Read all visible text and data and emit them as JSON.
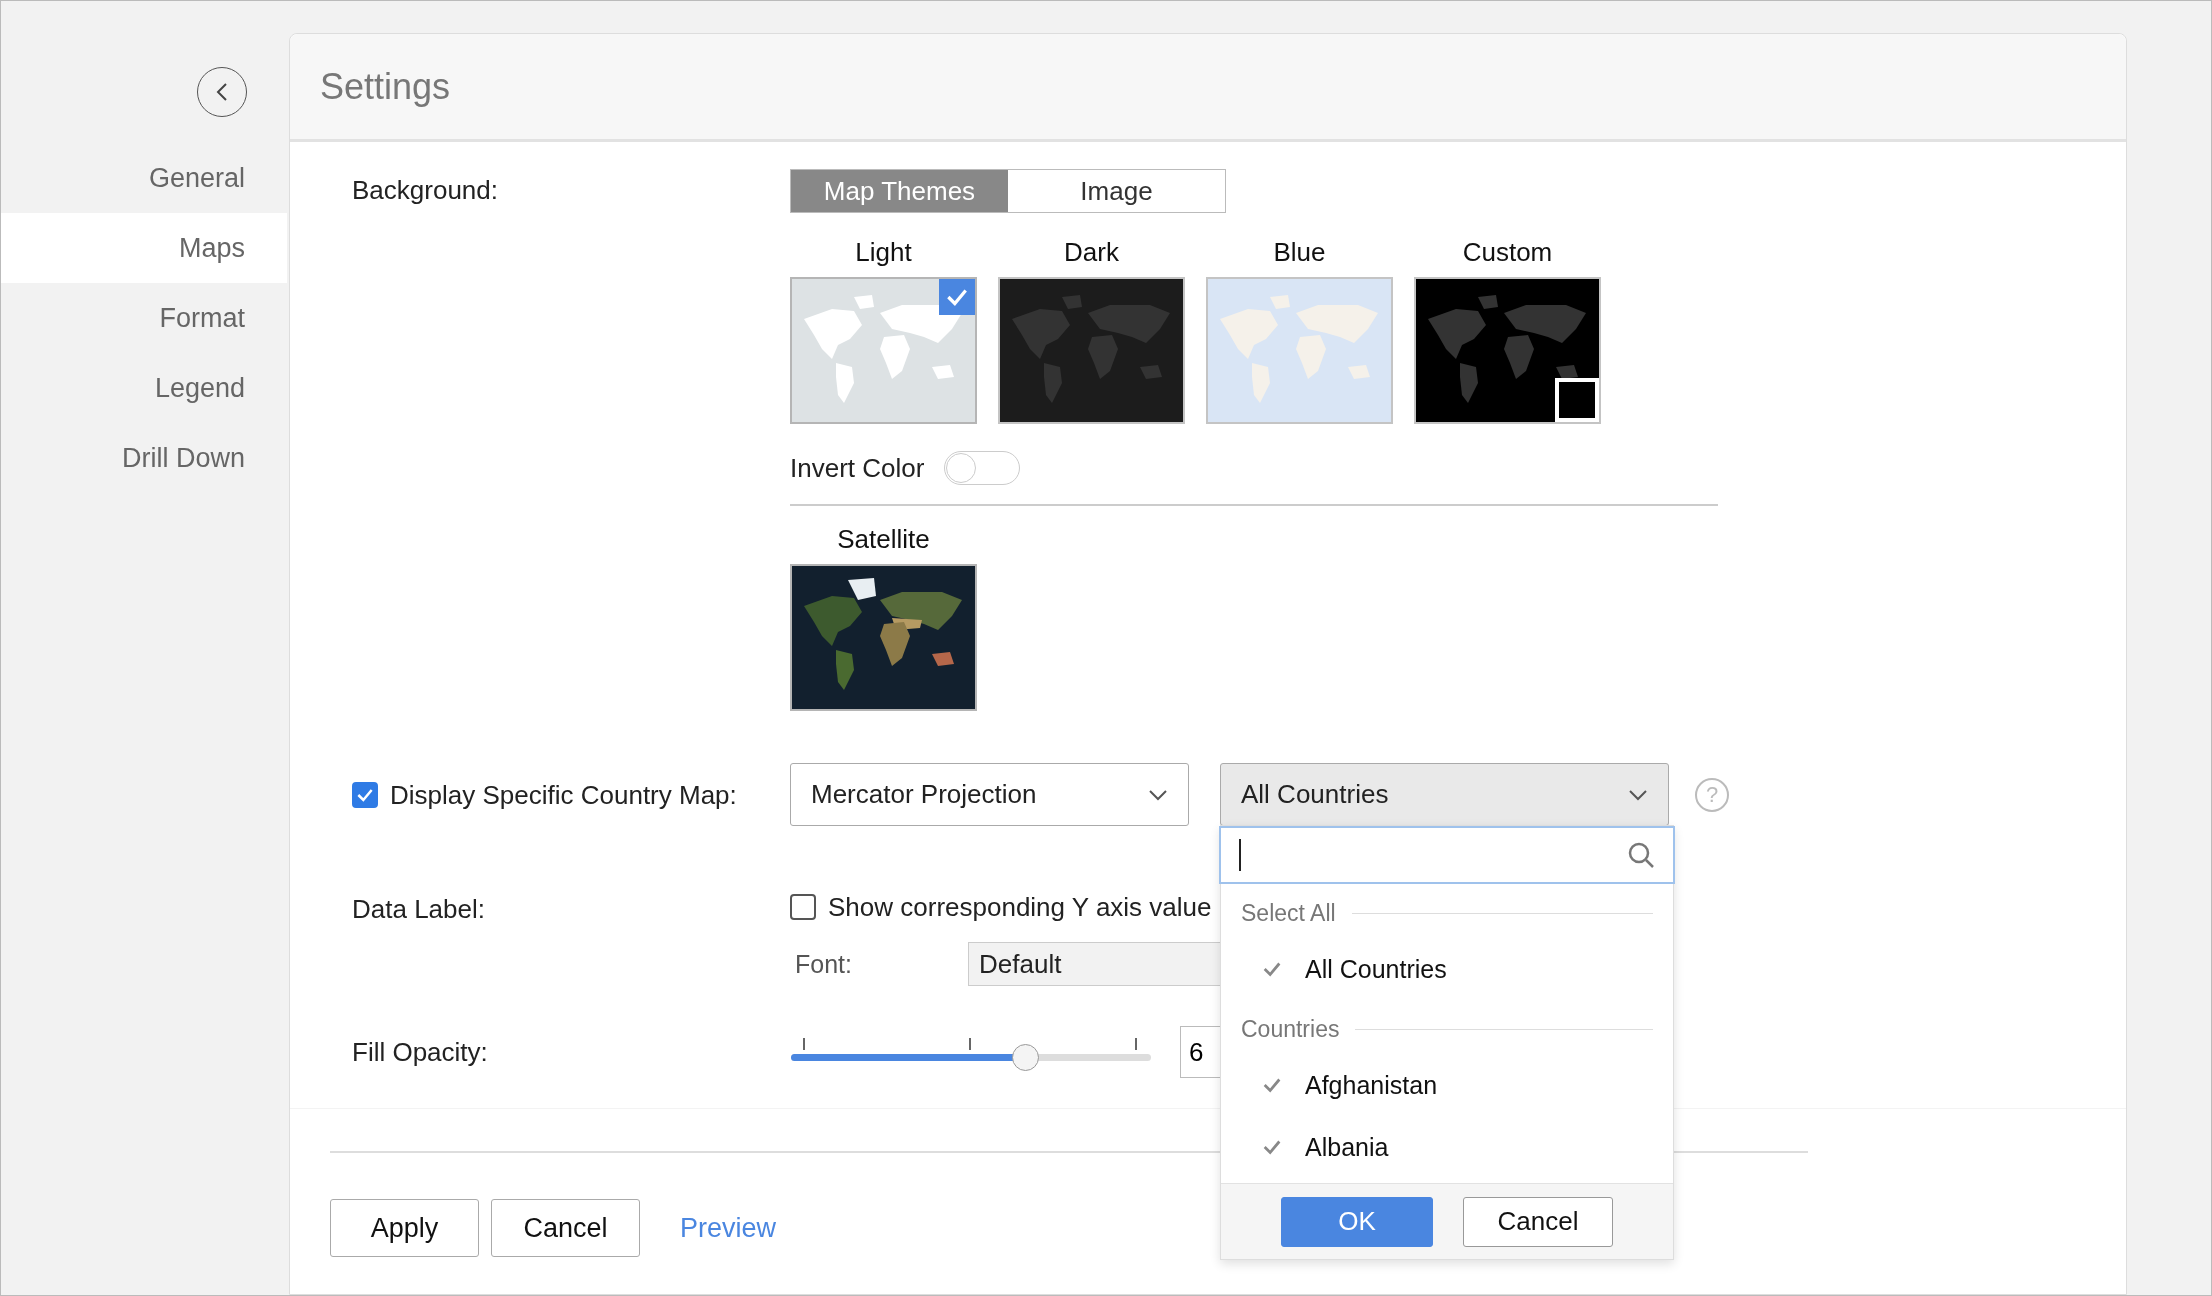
{
  "sidebar": {
    "items": [
      {
        "label": "General",
        "selected": false
      },
      {
        "label": "Maps",
        "selected": true
      },
      {
        "label": "Format",
        "selected": false
      },
      {
        "label": "Legend",
        "selected": false
      },
      {
        "label": "Drill Down",
        "selected": false
      }
    ]
  },
  "header": {
    "title": "Settings"
  },
  "background": {
    "label": "Background:",
    "tabs": [
      {
        "label": "Map Themes",
        "selected": true
      },
      {
        "label": "Image",
        "selected": false
      }
    ],
    "themes": [
      {
        "name": "Light",
        "kind": "light",
        "selected": true
      },
      {
        "name": "Dark",
        "kind": "dark",
        "selected": false
      },
      {
        "name": "Blue",
        "kind": "blue",
        "selected": false
      },
      {
        "name": "Custom",
        "kind": "custom",
        "selected": false,
        "color": "#000000"
      }
    ],
    "invert_color": {
      "label": "Invert Color",
      "on": false
    },
    "satellite": {
      "name": "Satellite",
      "selected": false
    }
  },
  "country_map": {
    "label": "Display Specific Country Map:",
    "checked": true,
    "projection": "Mercator Projection",
    "country": "All Countries",
    "dropdown": {
      "groups": [
        {
          "title": "Select All",
          "items": [
            {
              "label": "All Countries",
              "checked": true
            }
          ]
        },
        {
          "title": "Countries",
          "items": [
            {
              "label": "Afghanistan",
              "checked": true
            },
            {
              "label": "Albania",
              "checked": true
            }
          ]
        }
      ],
      "buttons": [
        "OK",
        "Cancel"
      ]
    },
    "help": "?"
  },
  "data_label": {
    "label": "Data Label:",
    "option": {
      "label": "Show corresponding Y axis value",
      "checked": false
    },
    "font": {
      "label": "Font:",
      "value": "Default"
    }
  },
  "fill_opacity": {
    "label": "Fill Opacity:",
    "level": 0.65,
    "value": "6"
  },
  "footer": {
    "buttons": [
      "Apply",
      "Cancel"
    ],
    "link": "Preview"
  }
}
